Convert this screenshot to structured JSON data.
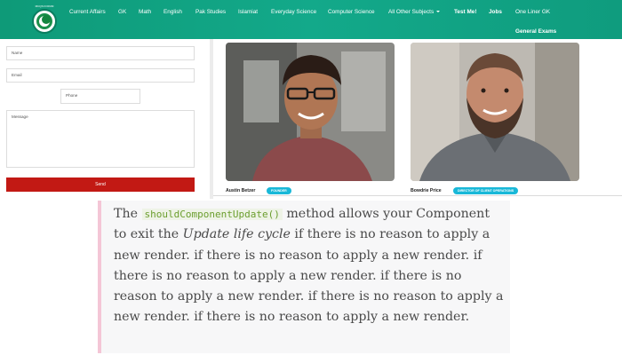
{
  "navbar": {
    "logo_text": "MCQS FORUM",
    "items": [
      {
        "label": "Current Affairs",
        "bold": false
      },
      {
        "label": "GK",
        "bold": false
      },
      {
        "label": "Math",
        "bold": false
      },
      {
        "label": "English",
        "bold": false
      },
      {
        "label": "Pak Studies",
        "bold": false
      },
      {
        "label": "Islamiat",
        "bold": false
      },
      {
        "label": "Everyday Science",
        "bold": false
      },
      {
        "label": "Computer Science",
        "bold": false
      },
      {
        "label": "All Other Subjects",
        "bold": false,
        "dropdown": true
      },
      {
        "label": "Test Me!",
        "bold": true
      },
      {
        "label": "Jobs",
        "bold": true
      },
      {
        "label": "One Liner GK",
        "bold": false
      },
      {
        "label": "General Exams",
        "bold": true
      }
    ]
  },
  "form": {
    "name_placeholder": "Name",
    "email_placeholder": "Email",
    "phone_placeholder": "Phone",
    "message_placeholder": "Message",
    "send_label": "Send",
    "send_color": "#c21914"
  },
  "people": [
    {
      "name": "Austin Betzer",
      "role": "FOUNDER",
      "icon": "portrait-young-man-glasses"
    },
    {
      "name": "Bowdrie Price",
      "role": "DIRECTOR OF CLIENT OPERATIONS",
      "icon": "portrait-bearded-man"
    }
  ],
  "quote": {
    "pre": "The ",
    "code": "shouldComponentUpdate()",
    "mid": " method allows your Component to exit the ",
    "em": "Update life cycle",
    "post": " if there is no reason to apply a new render. if there is no reason to apply a new render. if there is no reason to apply a new render. if there is no reason to apply a new render. if there is no reason to apply a new render. if there is no reason to apply a new render.",
    "accent_color": "#f4c6d6"
  },
  "colors": {
    "navbar": "#12a483",
    "badge": "#19b8d8"
  }
}
